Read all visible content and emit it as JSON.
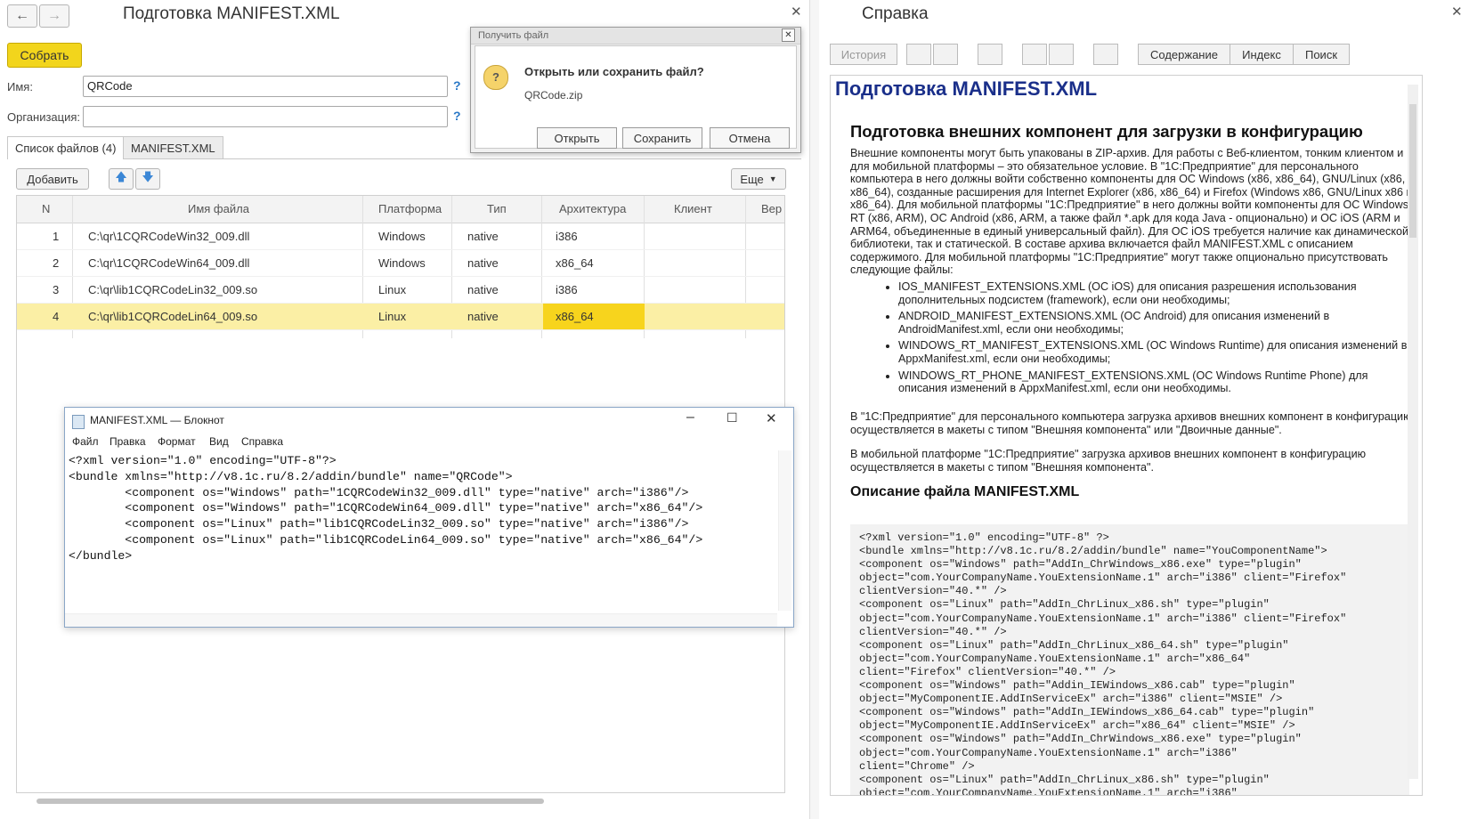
{
  "left": {
    "title": "Подготовка MANIFEST.XML",
    "collect_label": "Собрать",
    "name_label": "Имя:",
    "name_value": "QRCode",
    "org_label": "Организация:",
    "org_value": "",
    "help_mark": "?",
    "tabs": [
      "Список файлов (4)",
      "MANIFEST.XML"
    ],
    "add_label": "Добавить",
    "more_label": "Еще",
    "columns": [
      "N",
      "Имя файла",
      "Платформа",
      "Тип",
      "Архитектура",
      "Клиент",
      "Вер"
    ],
    "rows": [
      {
        "n": "1",
        "file": "C:\\qr\\1CQRCodeWin32_009.dll",
        "platform": "Windows",
        "type": "native",
        "arch": "i386",
        "client": ""
      },
      {
        "n": "2",
        "file": "C:\\qr\\1CQRCodeWin64_009.dll",
        "platform": "Windows",
        "type": "native",
        "arch": "x86_64",
        "client": ""
      },
      {
        "n": "3",
        "file": "C:\\qr\\lib1CQRCodeLin32_009.so",
        "platform": "Linux",
        "type": "native",
        "arch": "i386",
        "client": ""
      },
      {
        "n": "4",
        "file": "C:\\qr\\lib1CQRCodeLin64_009.so",
        "platform": "Linux",
        "type": "native",
        "arch": "x86_64",
        "client": ""
      }
    ]
  },
  "dialog": {
    "title": "Получить файл",
    "question": "Открыть или сохранить файл?",
    "filename": "QRCode.zip",
    "open_label": "Открыть",
    "save_label": "Сохранить",
    "cancel_label": "Отмена"
  },
  "notepad": {
    "title": "MANIFEST.XML — Блокнот",
    "menu": [
      "Файл",
      "Правка",
      "Формат",
      "Вид",
      "Справка"
    ],
    "content": "<?xml version=\"1.0\" encoding=\"UTF-8\"?>\n<bundle xmlns=\"http://v8.1c.ru/8.2/addin/bundle\" name=\"QRCode\">\n        <component os=\"Windows\" path=\"1CQRCodeWin32_009.dll\" type=\"native\" arch=\"i386\"/>\n        <component os=\"Windows\" path=\"1CQRCodeWin64_009.dll\" type=\"native\" arch=\"x86_64\"/>\n        <component os=\"Linux\" path=\"lib1CQRCodeLin32_009.so\" type=\"native\" arch=\"i386\"/>\n        <component os=\"Linux\" path=\"lib1CQRCodeLin64_009.so\" type=\"native\" arch=\"x86_64\"/>\n</bundle>"
  },
  "help": {
    "title": "Справка",
    "history_label": "История",
    "contents_label": "Содержание",
    "index_label": "Индекс",
    "search_label": "Поиск",
    "page_title": "Подготовка MANIFEST.XML",
    "heading": "Подготовка внешних компонент для загрузки в конфигурацию",
    "para1": "Внешние компоненты могут быть упакованы в ZIP-архив. Для работы с Веб-клиентом, тонким клиентом и для мобильной платформы – это обязательное условие. В \"1С:Предприятие\" для персонального компьютера в него должны войти собственно компоненты для ОС Windows (x86, x86_64), GNU/Linux (x86, x86_64), созданные расширения для Internet Explorer (x86, x86_64) и Firefox (Windows x86, GNU/Linux x86 и x86_64). Для мобильной платформы \"1С:Предприятие\" в него должны войти компоненты для ОС Windows RT (x86, ARM), ОС Android (x86, ARM, а также файл *.apk для кода Java - опционально) и ОС iOS (ARM и ARM64, объединенные в единый универсальный файл). Для ОС iOS требуется наличие как динамической библиотеки, так и статической. В составе архива включается файл MANIFEST.XML с описанием содержимого. Для мобильной платформы \"1С:Предприятие\" могут также опционально присутствовать следующие файлы:",
    "bullets": [
      "IOS_MANIFEST_EXTENSIONS.XML (ОС iOS) для описания разрешения использования дополнительных подсистем (framework), если они необходимы;",
      "ANDROID_MANIFEST_EXTENSIONS.XML (ОС Android) для описания изменений в AndroidManifest.xml, если они необходимы;",
      "WINDOWS_RT_MANIFEST_EXTENSIONS.XML (ОС Windows Runtime) для описания изменений в AppxManifest.xml, если они необходимы;",
      "WINDOWS_RT_PHONE_MANIFEST_EXTENSIONS.XML (ОС Windows Runtime Phone) для описания изменений в AppxManifest.xml, если они необходимы."
    ],
    "para2": "В \"1С:Предприятие\" для персонального компьютера загрузка архивов внешних компонент в конфигурацию осуществляется в макеты с типом \"Внешняя компонента\" или \"Двоичные данные\".",
    "para3": "В мобильной платформе \"1С:Предприятие\" загрузка архивов внешних компонент в конфигурацию осуществляется в макеты с типом \"Внешняя компонента\".",
    "subheading": "Описание файла MANIFEST.XML",
    "code": "<?xml version=\"1.0\" encoding=\"UTF-8\" ?>\n<bundle xmlns=\"http://v8.1c.ru/8.2/addin/bundle\" name=\"YouComponentName\">\n<component os=\"Windows\" path=\"AddIn_ChrWindows_x86.exe\" type=\"plugin\"\nobject=\"com.YourCompanyName.YouExtensionName.1\" arch=\"i386\" client=\"Firefox\"\nclientVersion=\"40.*\" />\n<component os=\"Linux\" path=\"AddIn_ChrLinux_x86.sh\" type=\"plugin\"\nobject=\"com.YourCompanyName.YouExtensionName.1\" arch=\"i386\" client=\"Firefox\"\nclientVersion=\"40.*\" />\n<component os=\"Linux\" path=\"AddIn_ChrLinux_x86_64.sh\" type=\"plugin\"\nobject=\"com.YourCompanyName.YouExtensionName.1\" arch=\"x86_64\"\nclient=\"Firefox\" clientVersion=\"40.*\" />\n<component os=\"Windows\" path=\"Addin_IEWindows_x86.cab\" type=\"plugin\"\nobject=\"MyComponentIE.AddInServiceEx\" arch=\"i386\" client=\"MSIE\" />\n<component os=\"Windows\" path=\"AddIn_IEWindows_x86_64.cab\" type=\"plugin\"\nobject=\"MyComponentIE.AddInServiceEx\" arch=\"x86_64\" client=\"MSIE\" />\n<component os=\"Windows\" path=\"AddIn_ChrWindows_x86.exe\" type=\"plugin\"\nobject=\"com.YourCompanyName.YouExtensionName.1\" arch=\"i386\"\nclient=\"Chrome\" />\n<component os=\"Linux\" path=\"AddIn_ChrLinux_x86.sh\" type=\"plugin\"\nobject=\"com.YourCompanyName.YouExtensionName.1\" arch=\"i386\""
  }
}
